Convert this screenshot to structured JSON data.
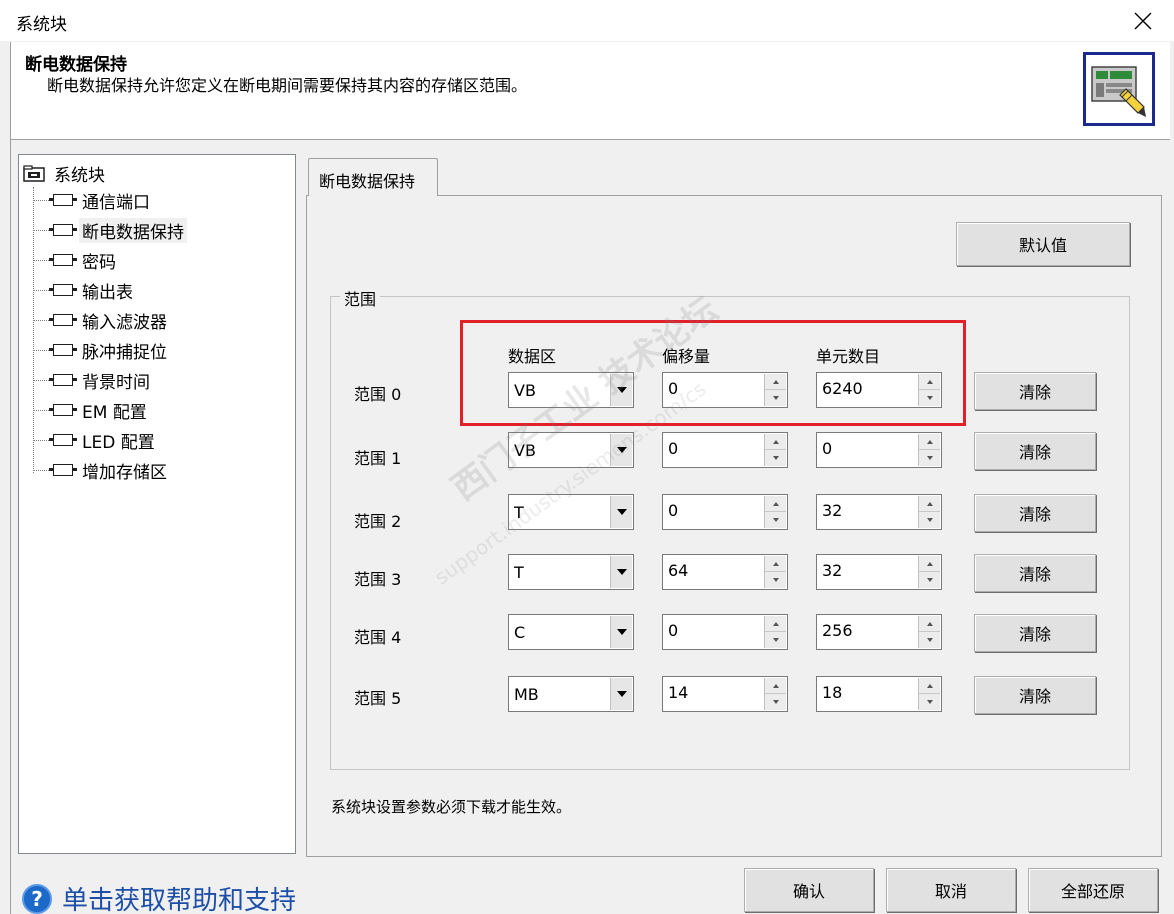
{
  "window": {
    "title": "系统块"
  },
  "header": {
    "title": "断电数据保持",
    "description": "断电数据保持允许您定义在断电期间需要保持其内容的存储区范围。"
  },
  "tree": {
    "root": "系统块",
    "items": [
      {
        "label": "通信端口"
      },
      {
        "label": "断电数据保持",
        "selected": true
      },
      {
        "label": "密码"
      },
      {
        "label": "输出表"
      },
      {
        "label": "输入滤波器"
      },
      {
        "label": "脉冲捕捉位"
      },
      {
        "label": "背景时间"
      },
      {
        "label": "EM 配置"
      },
      {
        "label": "LED 配置"
      },
      {
        "label": "增加存储区"
      }
    ]
  },
  "tab": {
    "label": "断电数据保持"
  },
  "page": {
    "default_button": "默认值",
    "group_label": "范围",
    "columns": {
      "area": "数据区",
      "offset": "偏移量",
      "count": "单元数目"
    },
    "clear_label": "清除",
    "ranges": [
      {
        "label": "范围 0",
        "area": "VB",
        "offset": "0",
        "count": "6240"
      },
      {
        "label": "范围 1",
        "area": "VB",
        "offset": "0",
        "count": "0"
      },
      {
        "label": "范围 2",
        "area": "T",
        "offset": "0",
        "count": "32"
      },
      {
        "label": "范围 3",
        "area": "T",
        "offset": "64",
        "count": "32"
      },
      {
        "label": "范围 4",
        "area": "C",
        "offset": "0",
        "count": "256"
      },
      {
        "label": "范围 5",
        "area": "MB",
        "offset": "14",
        "count": "18"
      }
    ],
    "note": "系统块设置参数必须下载才能生效。"
  },
  "footer": {
    "help_text": "单击获取帮助和支持",
    "ok": "确认",
    "cancel": "取消",
    "restore_all": "全部还原"
  },
  "watermark": {
    "line1": "西门子工业 技术论坛",
    "line2": "support.industry.siemens.com/cs"
  },
  "colors": {
    "highlight": "#e1202a",
    "help_link": "#1d4fa8",
    "icon_border": "#1c2a8f"
  }
}
